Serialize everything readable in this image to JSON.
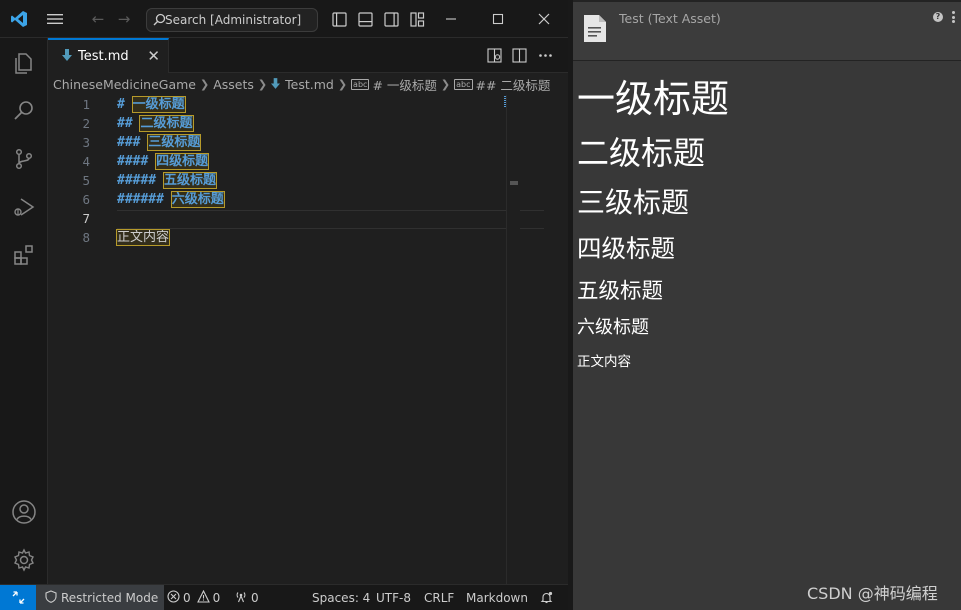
{
  "titlebar": {
    "search_text": "Search [Administrator]"
  },
  "tab": {
    "file_name": "Test.md"
  },
  "breadcrumb": {
    "items": [
      "ChineseMedicineGame",
      "Assets",
      "Test.md",
      "# 一级标题",
      "## 二级标题"
    ],
    "symbol_icon_text": "abc"
  },
  "editor": {
    "lines": [
      {
        "num": "1",
        "prefix": "# ",
        "text": "一级标题"
      },
      {
        "num": "2",
        "prefix": "## ",
        "text": "二级标题"
      },
      {
        "num": "3",
        "prefix": "### ",
        "text": "三级标题"
      },
      {
        "num": "4",
        "prefix": "#### ",
        "text": "四级标题"
      },
      {
        "num": "5",
        "prefix": "##### ",
        "text": "五级标题"
      },
      {
        "num": "6",
        "prefix": "###### ",
        "text": "六级标题"
      },
      {
        "num": "7",
        "prefix": "",
        "text": ""
      },
      {
        "num": "8",
        "prefix": "",
        "text": "正文内容"
      }
    ]
  },
  "statusbar": {
    "restricted": "Restricted Mode",
    "errors": "0",
    "warnings": "0",
    "ports": "0",
    "spaces": "Spaces: 4",
    "encoding": "UTF-8",
    "eol": "CRLF",
    "language": "Markdown"
  },
  "inspector": {
    "title": "Test (Text Asset)",
    "help_icon_text": "?",
    "preview": {
      "h1": "一级标题",
      "h2": "二级标题",
      "h3": "三级标题",
      "h4": "四级标题",
      "h5": "五级标题",
      "h6": "六级标题",
      "body": "正文内容"
    }
  },
  "watermark": "CSDN @神码编程",
  "colors": {
    "accent": "#0078d4",
    "keyword": "#569cd6",
    "highlight_border": "#b69a2a"
  }
}
